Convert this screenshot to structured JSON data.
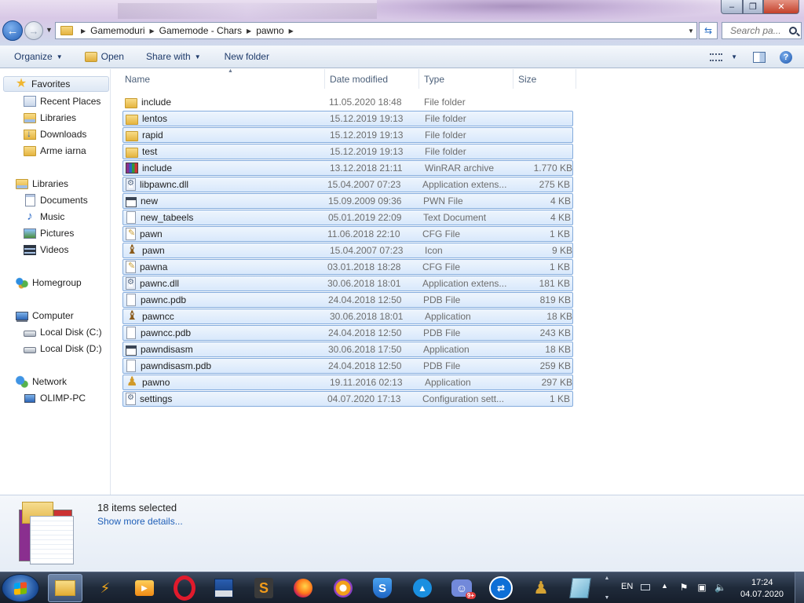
{
  "window": {
    "controls": {
      "minimize": "–",
      "maximize": "❐",
      "close": "✕"
    }
  },
  "address": {
    "crumbs": [
      "Gamemoduri",
      "Gamemode - Chars",
      "pawno"
    ],
    "search_placeholder": "Search pa..."
  },
  "toolbar": {
    "organize": "Organize",
    "open": "Open",
    "share_with": "Share with",
    "new_folder": "New folder"
  },
  "nav": {
    "favorites": "Favorites",
    "recent_places": "Recent Places",
    "fav_libraries": "Libraries",
    "downloads": "Downloads",
    "arme_iarna": "Arme iarna",
    "libraries": "Libraries",
    "documents": "Documents",
    "music": "Music",
    "pictures": "Pictures",
    "videos": "Videos",
    "homegroup": "Homegroup",
    "computer": "Computer",
    "local_c": "Local Disk (C:)",
    "local_d": "Local Disk (D:)",
    "network": "Network",
    "olimp_pc": "OLIMP-PC"
  },
  "columns": {
    "name": "Name",
    "date": "Date modified",
    "type": "Type",
    "size": "Size"
  },
  "files": [
    {
      "name": "include",
      "date": "11.05.2020 18:48",
      "type": "File folder",
      "size": "",
      "icon": "folder-icon",
      "selected": false
    },
    {
      "name": "lentos",
      "date": "15.12.2019 19:13",
      "type": "File folder",
      "size": "",
      "icon": "folder-icon",
      "selected": true
    },
    {
      "name": "rapid",
      "date": "15.12.2019 19:13",
      "type": "File folder",
      "size": "",
      "icon": "folder-icon",
      "selected": true
    },
    {
      "name": "test",
      "date": "15.12.2019 19:13",
      "type": "File folder",
      "size": "",
      "icon": "folder-icon",
      "selected": true
    },
    {
      "name": "include",
      "date": "13.12.2018 21:11",
      "type": "WinRAR archive",
      "size": "1.770 KB",
      "icon": "winrar-icon",
      "selected": true
    },
    {
      "name": "libpawnc.dll",
      "date": "15.04.2007 07:23",
      "type": "Application extens...",
      "size": "275 KB",
      "icon": "dll-icon",
      "selected": true
    },
    {
      "name": "new",
      "date": "15.09.2009 09:36",
      "type": "PWN File",
      "size": "4 KB",
      "icon": "window-file-icon",
      "selected": true
    },
    {
      "name": "new_tabeels",
      "date": "05.01.2019 22:09",
      "type": "Text Document",
      "size": "4 KB",
      "icon": "text-file-icon",
      "selected": true
    },
    {
      "name": "pawn",
      "date": "11.06.2018 22:10",
      "type": "CFG File",
      "size": "1 KB",
      "icon": "cfg-file-icon",
      "selected": true
    },
    {
      "name": "pawn",
      "date": "15.04.2007 07:23",
      "type": "Icon",
      "size": "9 KB",
      "icon": "pawn-icon",
      "selected": true
    },
    {
      "name": "pawna",
      "date": "03.01.2018 18:28",
      "type": "CFG File",
      "size": "1 KB",
      "icon": "cfg-file-icon",
      "selected": true
    },
    {
      "name": "pawnc.dll",
      "date": "30.06.2018 18:01",
      "type": "Application extens...",
      "size": "181 KB",
      "icon": "dll-icon",
      "selected": true
    },
    {
      "name": "pawnc.pdb",
      "date": "24.04.2018 12:50",
      "type": "PDB File",
      "size": "819 KB",
      "icon": "blank-file-icon",
      "selected": true
    },
    {
      "name": "pawncc",
      "date": "30.06.2018 18:01",
      "type": "Application",
      "size": "18 KB",
      "icon": "pawn-icon",
      "selected": true
    },
    {
      "name": "pawncc.pdb",
      "date": "24.04.2018 12:50",
      "type": "PDB File",
      "size": "243 KB",
      "icon": "blank-file-icon",
      "selected": true
    },
    {
      "name": "pawndisasm",
      "date": "30.06.2018 17:50",
      "type": "Application",
      "size": "18 KB",
      "icon": "window-file-icon",
      "selected": true
    },
    {
      "name": "pawndisasm.pdb",
      "date": "24.04.2018 12:50",
      "type": "PDB File",
      "size": "259 KB",
      "icon": "blank-file-icon",
      "selected": true
    },
    {
      "name": "pawno",
      "date": "19.11.2016 02:13",
      "type": "Application",
      "size": "297 KB",
      "icon": "pawno-icon",
      "selected": true
    },
    {
      "name": "settings",
      "date": "04.07.2020 17:13",
      "type": "Configuration sett...",
      "size": "1 KB",
      "icon": "settings-file-icon",
      "selected": true
    }
  ],
  "details": {
    "selection_count": "18 items selected",
    "show_more": "Show more details..."
  },
  "taskbar": {
    "discord_badge": "9+",
    "language": "EN",
    "time": "17:24",
    "date": "04.07.2020"
  }
}
